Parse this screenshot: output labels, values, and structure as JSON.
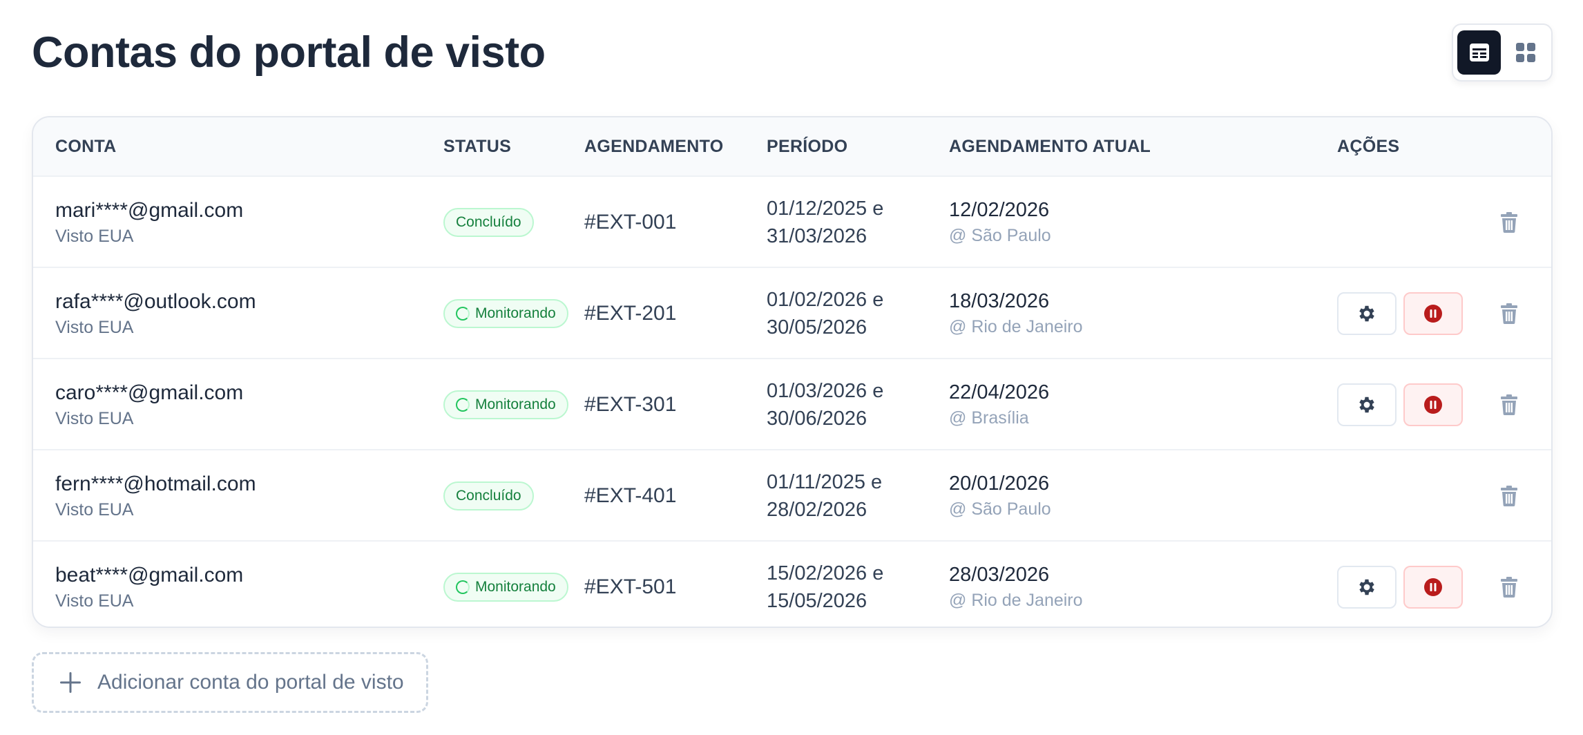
{
  "page": {
    "title": "Contas do portal de visto"
  },
  "view_toggle": {
    "active": "table-view",
    "options": [
      "table-view-icon",
      "grid-view-icon"
    ]
  },
  "table": {
    "columns": {
      "account": "CONTA",
      "status": "STATUS",
      "schedule": "AGENDAMENTO",
      "period": "PERÍODO",
      "current": "AGENDAMENTO ATUAL",
      "actions": "AÇÕES"
    },
    "rows": [
      {
        "email": "mari****@gmail.com",
        "visa": "Visto EUA",
        "status": "Concluído",
        "monitoring": false,
        "ref": "#EXT-001",
        "period_start": "01/12/2025 e",
        "period_end": "31/03/2026",
        "appt_date": "12/02/2026",
        "appt_loc": "@ São Paulo"
      },
      {
        "email": "rafa****@outlook.com",
        "visa": "Visto EUA",
        "status": "Monitorando",
        "monitoring": true,
        "ref": "#EXT-201",
        "period_start": "01/02/2026 e",
        "period_end": "30/05/2026",
        "appt_date": "18/03/2026",
        "appt_loc": "@ Rio de Janeiro"
      },
      {
        "email": "caro****@gmail.com",
        "visa": "Visto EUA",
        "status": "Monitorando",
        "monitoring": true,
        "ref": "#EXT-301",
        "period_start": "01/03/2026 e",
        "period_end": "30/06/2026",
        "appt_date": "22/04/2026",
        "appt_loc": "@ Brasília"
      },
      {
        "email": "fern****@hotmail.com",
        "visa": "Visto EUA",
        "status": "Concluído",
        "monitoring": false,
        "ref": "#EXT-401",
        "period_start": "01/11/2025 e",
        "period_end": "28/02/2026",
        "appt_date": "20/01/2026",
        "appt_loc": "@ São Paulo"
      },
      {
        "email": "beat****@gmail.com",
        "visa": "Visto EUA",
        "status": "Monitorando",
        "monitoring": true,
        "ref": "#EXT-501",
        "period_start": "15/02/2026 e",
        "period_end": "15/05/2026",
        "appt_date": "28/03/2026",
        "appt_loc": "@ Rio de Janeiro"
      }
    ]
  },
  "add_button": {
    "label": "Adicionar conta do portal de visto"
  },
  "colors": {
    "primary_dark": "#111827",
    "success": "#15803d",
    "success_bg": "#f0fdf4",
    "danger": "#b91c1c",
    "danger_bg": "#fef2f2",
    "muted": "#94a3b8"
  }
}
